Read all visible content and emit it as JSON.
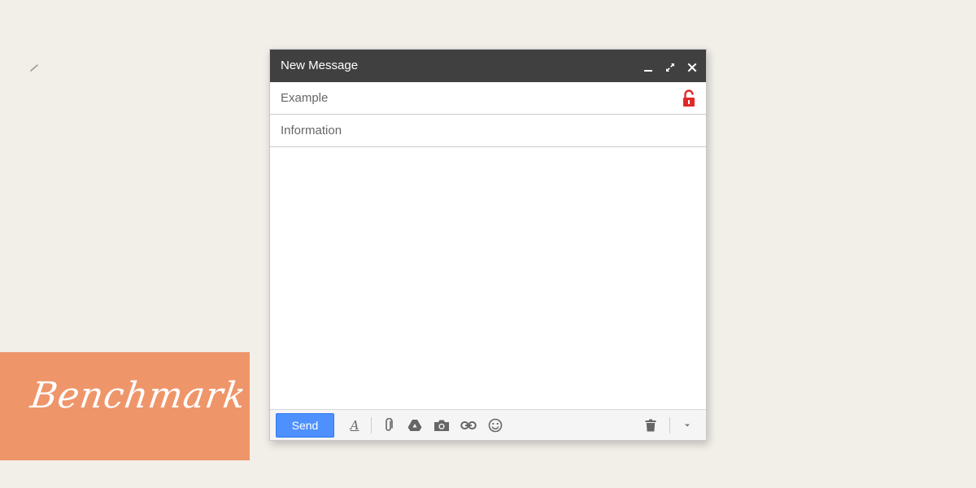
{
  "window": {
    "title": "New Message"
  },
  "fields": {
    "to_value": "Example",
    "subject_value": "Information"
  },
  "toolbar": {
    "send_label": "Send",
    "format_label": "A"
  },
  "brand": {
    "logo_text": "Benchmark"
  },
  "colors": {
    "page_bg": "#f2efe9",
    "brand_block": "#ef956a",
    "titlebar": "#404040",
    "send_button": "#4d90fe",
    "lock_icon": "#e02a2a"
  },
  "icons": [
    "minimize-icon",
    "expand-icon",
    "close-icon",
    "unlock-icon",
    "format-text-icon",
    "attach-icon",
    "drive-icon",
    "camera-icon",
    "link-icon",
    "emoji-icon",
    "trash-icon",
    "more-options-icon"
  ]
}
